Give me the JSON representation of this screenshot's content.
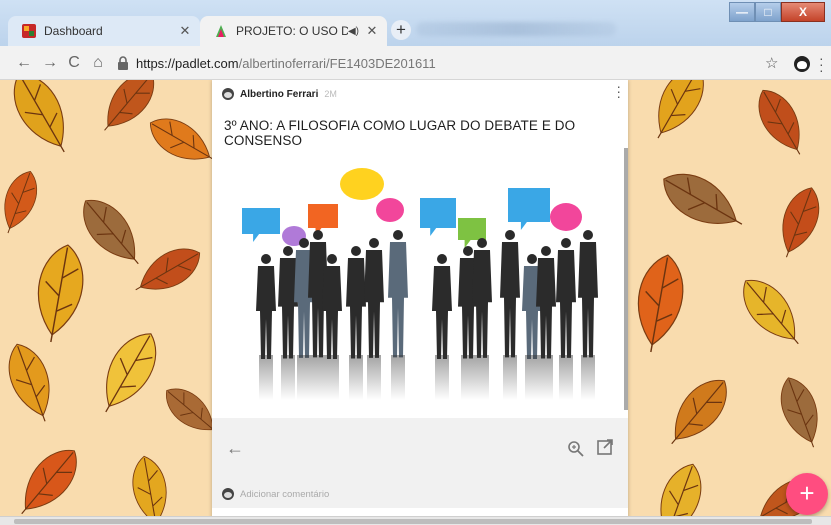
{
  "browser": {
    "tabs": [
      {
        "title": "Dashboard",
        "active": false
      },
      {
        "title": "PROJETO: O USO DAS TECN",
        "active": true
      }
    ],
    "new_tab_label": "+",
    "url_host": "https://padlet.com",
    "url_path": "/albertinoferrari/FE1403DE201611",
    "window_buttons": {
      "minimize": "—",
      "maximize": "□",
      "close": "X"
    }
  },
  "post": {
    "author": "Albertino Ferrari",
    "time": "2M",
    "title": "3º ANO: A FILOSOFIA COMO LUGAR DO DEBATE E DO CONSENSO",
    "comment_placeholder": "Adicionar comentário"
  },
  "fab_label": "+",
  "colors": {
    "background": "#f9dcae",
    "accent_fab": "#ff4d80",
    "bubble_blue": "#3aa7e6",
    "bubble_orange": "#f26522",
    "bubble_yellow": "#ffd21f",
    "bubble_pink": "#f2469b",
    "bubble_green": "#7ec242",
    "bubble_purple": "#b07ad8"
  },
  "icons": [
    "back-arrow-icon",
    "forward-arrow-icon",
    "reload-icon",
    "home-icon",
    "lock-icon",
    "star-icon",
    "zoom-icon",
    "open-external-icon",
    "more-vert-icon"
  ]
}
